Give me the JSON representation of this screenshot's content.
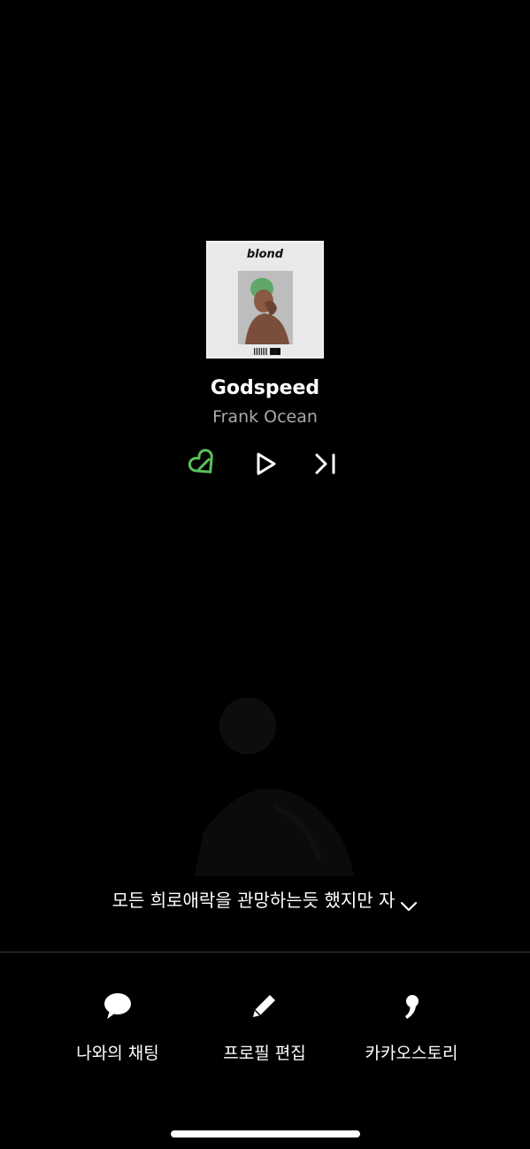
{
  "album": {
    "cover_title": "blond"
  },
  "track": {
    "title": "Godspeed",
    "artist": "Frank Ocean",
    "liked": true,
    "accent_color": "#5cc05a"
  },
  "controls": {
    "like_icon": "heart-broken-icon",
    "play_icon": "play-icon",
    "next_icon": "skip-next-icon"
  },
  "profile": {
    "status_message": "모든 희로애락을 관망하는듯 했지만 자"
  },
  "actions": [
    {
      "label": "나와의 채팅",
      "icon": "chat-bubble-icon"
    },
    {
      "label": "프로필 편집",
      "icon": "pencil-icon"
    },
    {
      "label": "카카오스토리",
      "icon": "comma-icon"
    }
  ]
}
